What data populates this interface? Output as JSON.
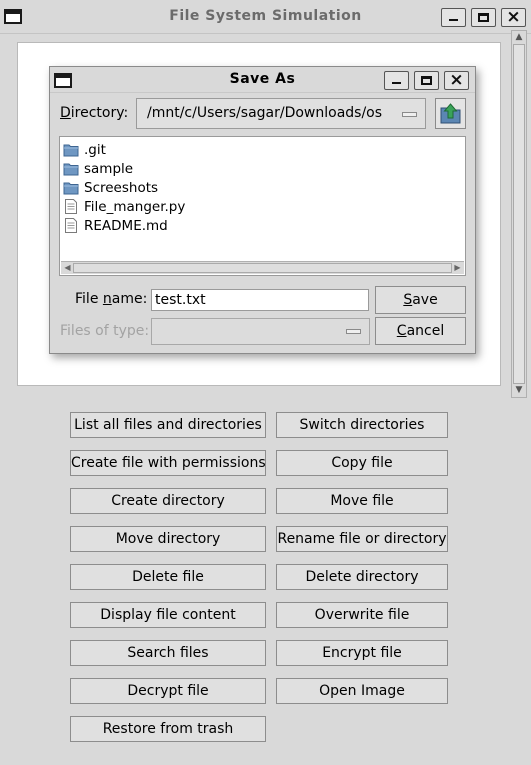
{
  "window": {
    "title": "File System Simulation"
  },
  "dialog": {
    "title": "Save As",
    "directory_label_mnemonic": "D",
    "directory_label_rest": "irectory:",
    "directory_value": "/mnt/c/Users/sagar/Downloads/os",
    "files": [
      {
        "name": ".git",
        "type": "folder"
      },
      {
        "name": "sample",
        "type": "folder"
      },
      {
        "name": "Screeshots",
        "type": "folder"
      },
      {
        "name": "File_manger.py",
        "type": "file"
      },
      {
        "name": "README.md",
        "type": "file"
      }
    ],
    "filename_label_pre": "File ",
    "filename_label_mnemonic": "n",
    "filename_label_post": "ame:",
    "filename_value": "test.txt",
    "filetype_label": "Files of type:",
    "filetype_value": "",
    "save_mnemonic": "S",
    "save_rest": "ave",
    "cancel_mnemonic": "C",
    "cancel_rest": "ancel"
  },
  "actions": {
    "left": [
      "List all files and directories",
      "Create file with permissions",
      "Create directory",
      "Move directory",
      "Delete file",
      "Display file content",
      "Search files",
      "Decrypt file",
      "Restore from trash"
    ],
    "right": [
      "Switch directories",
      "Copy file",
      "Move file",
      "Rename file or directory",
      "Delete directory",
      "Overwrite file",
      "Encrypt file",
      "Open Image"
    ]
  },
  "colors": {
    "background": "#d9d9d9",
    "folder_icon": "#5b86b3",
    "up_arrow": "#3aa35a"
  }
}
